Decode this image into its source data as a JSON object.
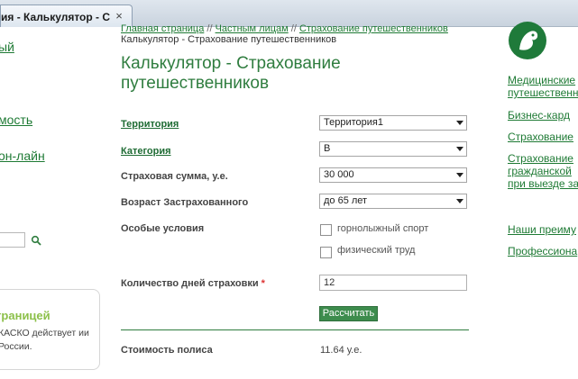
{
  "browser": {
    "tab_title": "ия - Калькулятор - С",
    "close_glyph": "×"
  },
  "left": {
    "links": [
      "ый",
      "мость",
      "он-лайн"
    ],
    "promo_title": "границей",
    "promo_text": "КАСКО действует ии России."
  },
  "breadcrumbs": {
    "home": "Главная страница",
    "sep1": " // ",
    "private": "Частным лицам",
    "sep2": " // ",
    "insurance": "Страхование путешественников",
    "current": "Калькулятор - Страхование путешественников"
  },
  "page": {
    "title": "Калькулятор - Страхование путешественников"
  },
  "form": {
    "territory": {
      "label": "Территория",
      "value": "Территория1"
    },
    "category": {
      "label": "Категория",
      "value": "B"
    },
    "sum": {
      "label": "Страховая сумма, у.е.",
      "value": "30 000"
    },
    "age": {
      "label": "Возраст Застрахованного",
      "value": "до 65 лет"
    },
    "special": {
      "label": "Особые условия",
      "options": [
        {
          "label": "горнолыжный спорт",
          "checked": false
        },
        {
          "label": "физический труд",
          "checked": false
        }
      ]
    },
    "days": {
      "label": "Количество дней страховки",
      "required_mark": "*",
      "value": "12"
    },
    "calc_button": "Рассчитать"
  },
  "result": {
    "label": "Стоимость полиса",
    "value": "11.64 у.е."
  },
  "right": {
    "links": [
      "Медицинские",
      "путешественн",
      "Бизнес-кард",
      "Страхование",
      "Страхование",
      "гражданской",
      "при выезде за",
      "Наши преиму",
      "Профессиона"
    ]
  },
  "colors": {
    "brand_green": "#2f7d3f",
    "link_green": "#1e7a34",
    "promo_green": "#8cc04a"
  }
}
